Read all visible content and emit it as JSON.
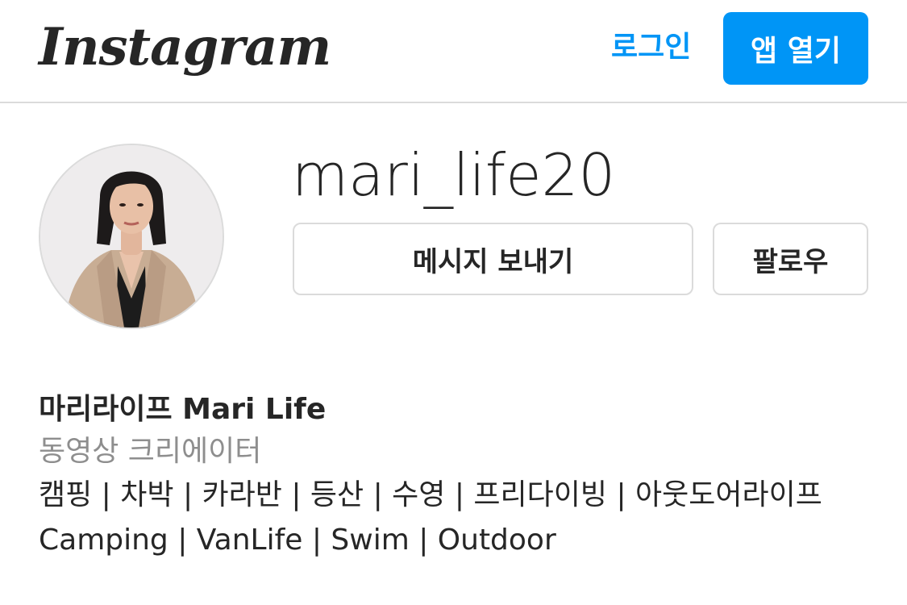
{
  "header": {
    "logo_text": "Instagram",
    "login_label": "로그인",
    "open_app_label": "앱 열기",
    "accent_color": "#0095f6"
  },
  "profile": {
    "username": "mari_life20",
    "message_label": "메시지 보내기",
    "follow_label": "팔로우"
  },
  "bio": {
    "name": "마리라이프 Mari Life",
    "category": "동영상 크리에이터",
    "line1": "캠핑 | 차박 | 카라반 | 등산 | 수영 | 프리다이빙 | 아웃도어라이프",
    "line2": "Camping | VanLife | Swim | Outdoor"
  }
}
